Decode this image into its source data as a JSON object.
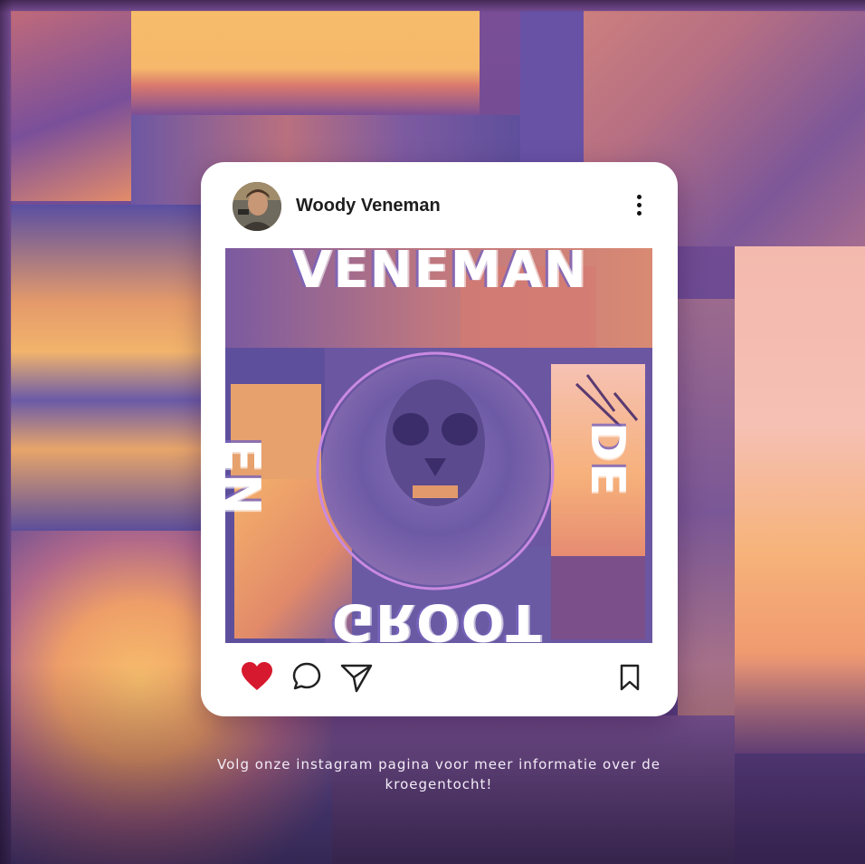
{
  "post": {
    "username": "Woody Veneman",
    "artwork_words": {
      "top": "VENEMAN",
      "bottom": "GROOT",
      "left": "EN",
      "right": "DE"
    }
  },
  "caption": "Volg onze instagram pagina voor meer informatie over de kroegentocht!",
  "icons": {
    "like": "heart-icon",
    "comment": "comment-icon",
    "share": "send-icon",
    "save": "bookmark-icon",
    "more": "more-vertical-icon"
  },
  "colors": {
    "like": "#d7192f",
    "accent_orange": "#f6b96c",
    "accent_purple": "#6e56a0",
    "accent_pink": "#ef8f8b"
  }
}
